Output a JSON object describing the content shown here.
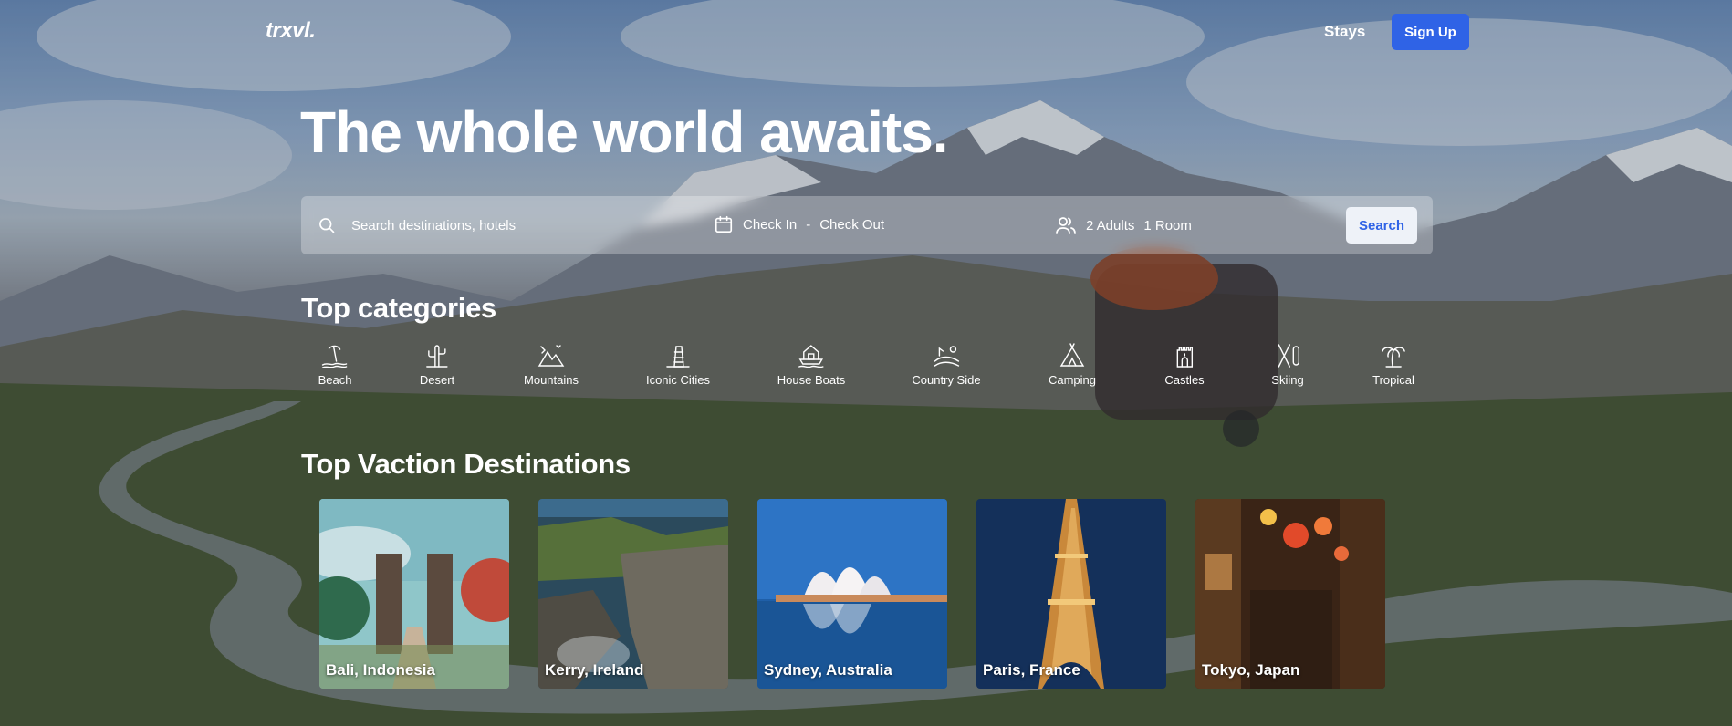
{
  "nav": {
    "logo": "trxvl.",
    "stays_label": "Stays",
    "signup_label": "Sign Up"
  },
  "hero": {
    "headline": "The whole world awaits."
  },
  "search": {
    "placeholder": "Search destinations, hotels",
    "check_in": "Check In",
    "separator": "-",
    "check_out": "Check Out",
    "adults": "2 Adults",
    "rooms": "1 Room",
    "button_label": "Search",
    "button_color": "#2f63e6"
  },
  "categories": {
    "title": "Top categories",
    "items": [
      {
        "label": "Beach",
        "icon": "beach-icon"
      },
      {
        "label": "Desert",
        "icon": "cactus-icon"
      },
      {
        "label": "Mountains",
        "icon": "mountain-icon"
      },
      {
        "label": "Iconic Cities",
        "icon": "tower-icon"
      },
      {
        "label": "House Boats",
        "icon": "houseboat-icon"
      },
      {
        "label": "Country Side",
        "icon": "countryside-icon"
      },
      {
        "label": "Camping",
        "icon": "tent-icon"
      },
      {
        "label": "Castles",
        "icon": "castle-icon"
      },
      {
        "label": "Skiing",
        "icon": "ski-icon"
      },
      {
        "label": "Tropical",
        "icon": "palm-tree-icon"
      }
    ]
  },
  "destinations": {
    "title": "Top Vaction Destinations",
    "items": [
      {
        "label": "Bali, Indonesia"
      },
      {
        "label": "Kerry, Ireland"
      },
      {
        "label": "Sydney, Australia"
      },
      {
        "label": "Paris, France"
      },
      {
        "label": "Tokyo, Japan"
      }
    ]
  },
  "colors": {
    "accent": "#2f63e6",
    "text": "#ffffff"
  }
}
